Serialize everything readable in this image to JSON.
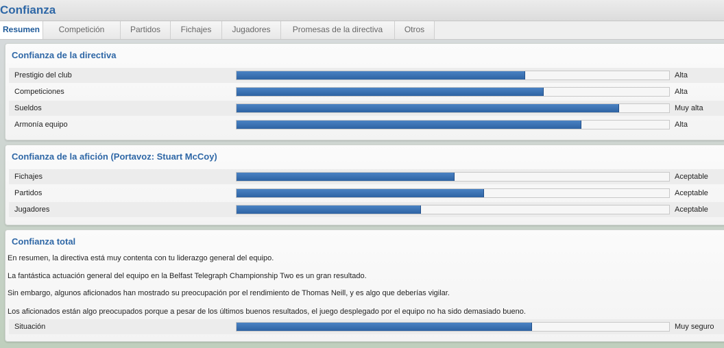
{
  "window": {
    "title": "Confianza"
  },
  "tabs": [
    {
      "label": "Resumen",
      "active": true
    },
    {
      "label": "Competición",
      "active": false
    },
    {
      "label": "Partidos",
      "active": false
    },
    {
      "label": "Fichajes",
      "active": false
    },
    {
      "label": "Jugadores",
      "active": false
    },
    {
      "label": "Promesas de la directiva",
      "active": false
    },
    {
      "label": "Otros",
      "active": false
    }
  ],
  "board": {
    "title": "Confianza de la directiva",
    "rows": [
      {
        "label": "Prestigio del club",
        "level": 0.665,
        "value": "Alta"
      },
      {
        "label": "Competiciones",
        "level": 0.708,
        "value": "Alta"
      },
      {
        "label": "Sueldos",
        "level": 0.883,
        "value": "Muy alta"
      },
      {
        "label": "Armonía equipo",
        "level": 0.796,
        "value": "Alta"
      }
    ]
  },
  "fans": {
    "title": "Confianza de la afición (Portavoz: Stuart McCoy)",
    "rows": [
      {
        "label": "Fichajes",
        "level": 0.502,
        "value": "Aceptable"
      },
      {
        "label": "Partidos",
        "level": 0.571,
        "value": "Aceptable"
      },
      {
        "label": "Jugadores",
        "level": 0.424,
        "value": "Aceptable"
      }
    ]
  },
  "overall": {
    "title": "Confianza total",
    "paragraphs": [
      "En resumen, la directiva está muy contenta con tu liderazgo general del equipo.",
      "La fantástica actuación general del equipo en la Belfast Telegraph Championship Two es un gran resultado.",
      "Sin embargo, algunos aficionados han mostrado su preocupación por el rendimiento de Thomas Neill, y es algo que deberías vigilar.",
      "Los aficionados están algo preocupados porque a pesar de los últimos buenos resultados, el juego desplegado por el equipo no ha sido demasiado bueno."
    ],
    "situation": {
      "label": "Situación",
      "level": 0.681,
      "value": "Muy seguro"
    }
  },
  "colors": {
    "accent": "#2e67a6",
    "bar": "#2e63a3"
  }
}
